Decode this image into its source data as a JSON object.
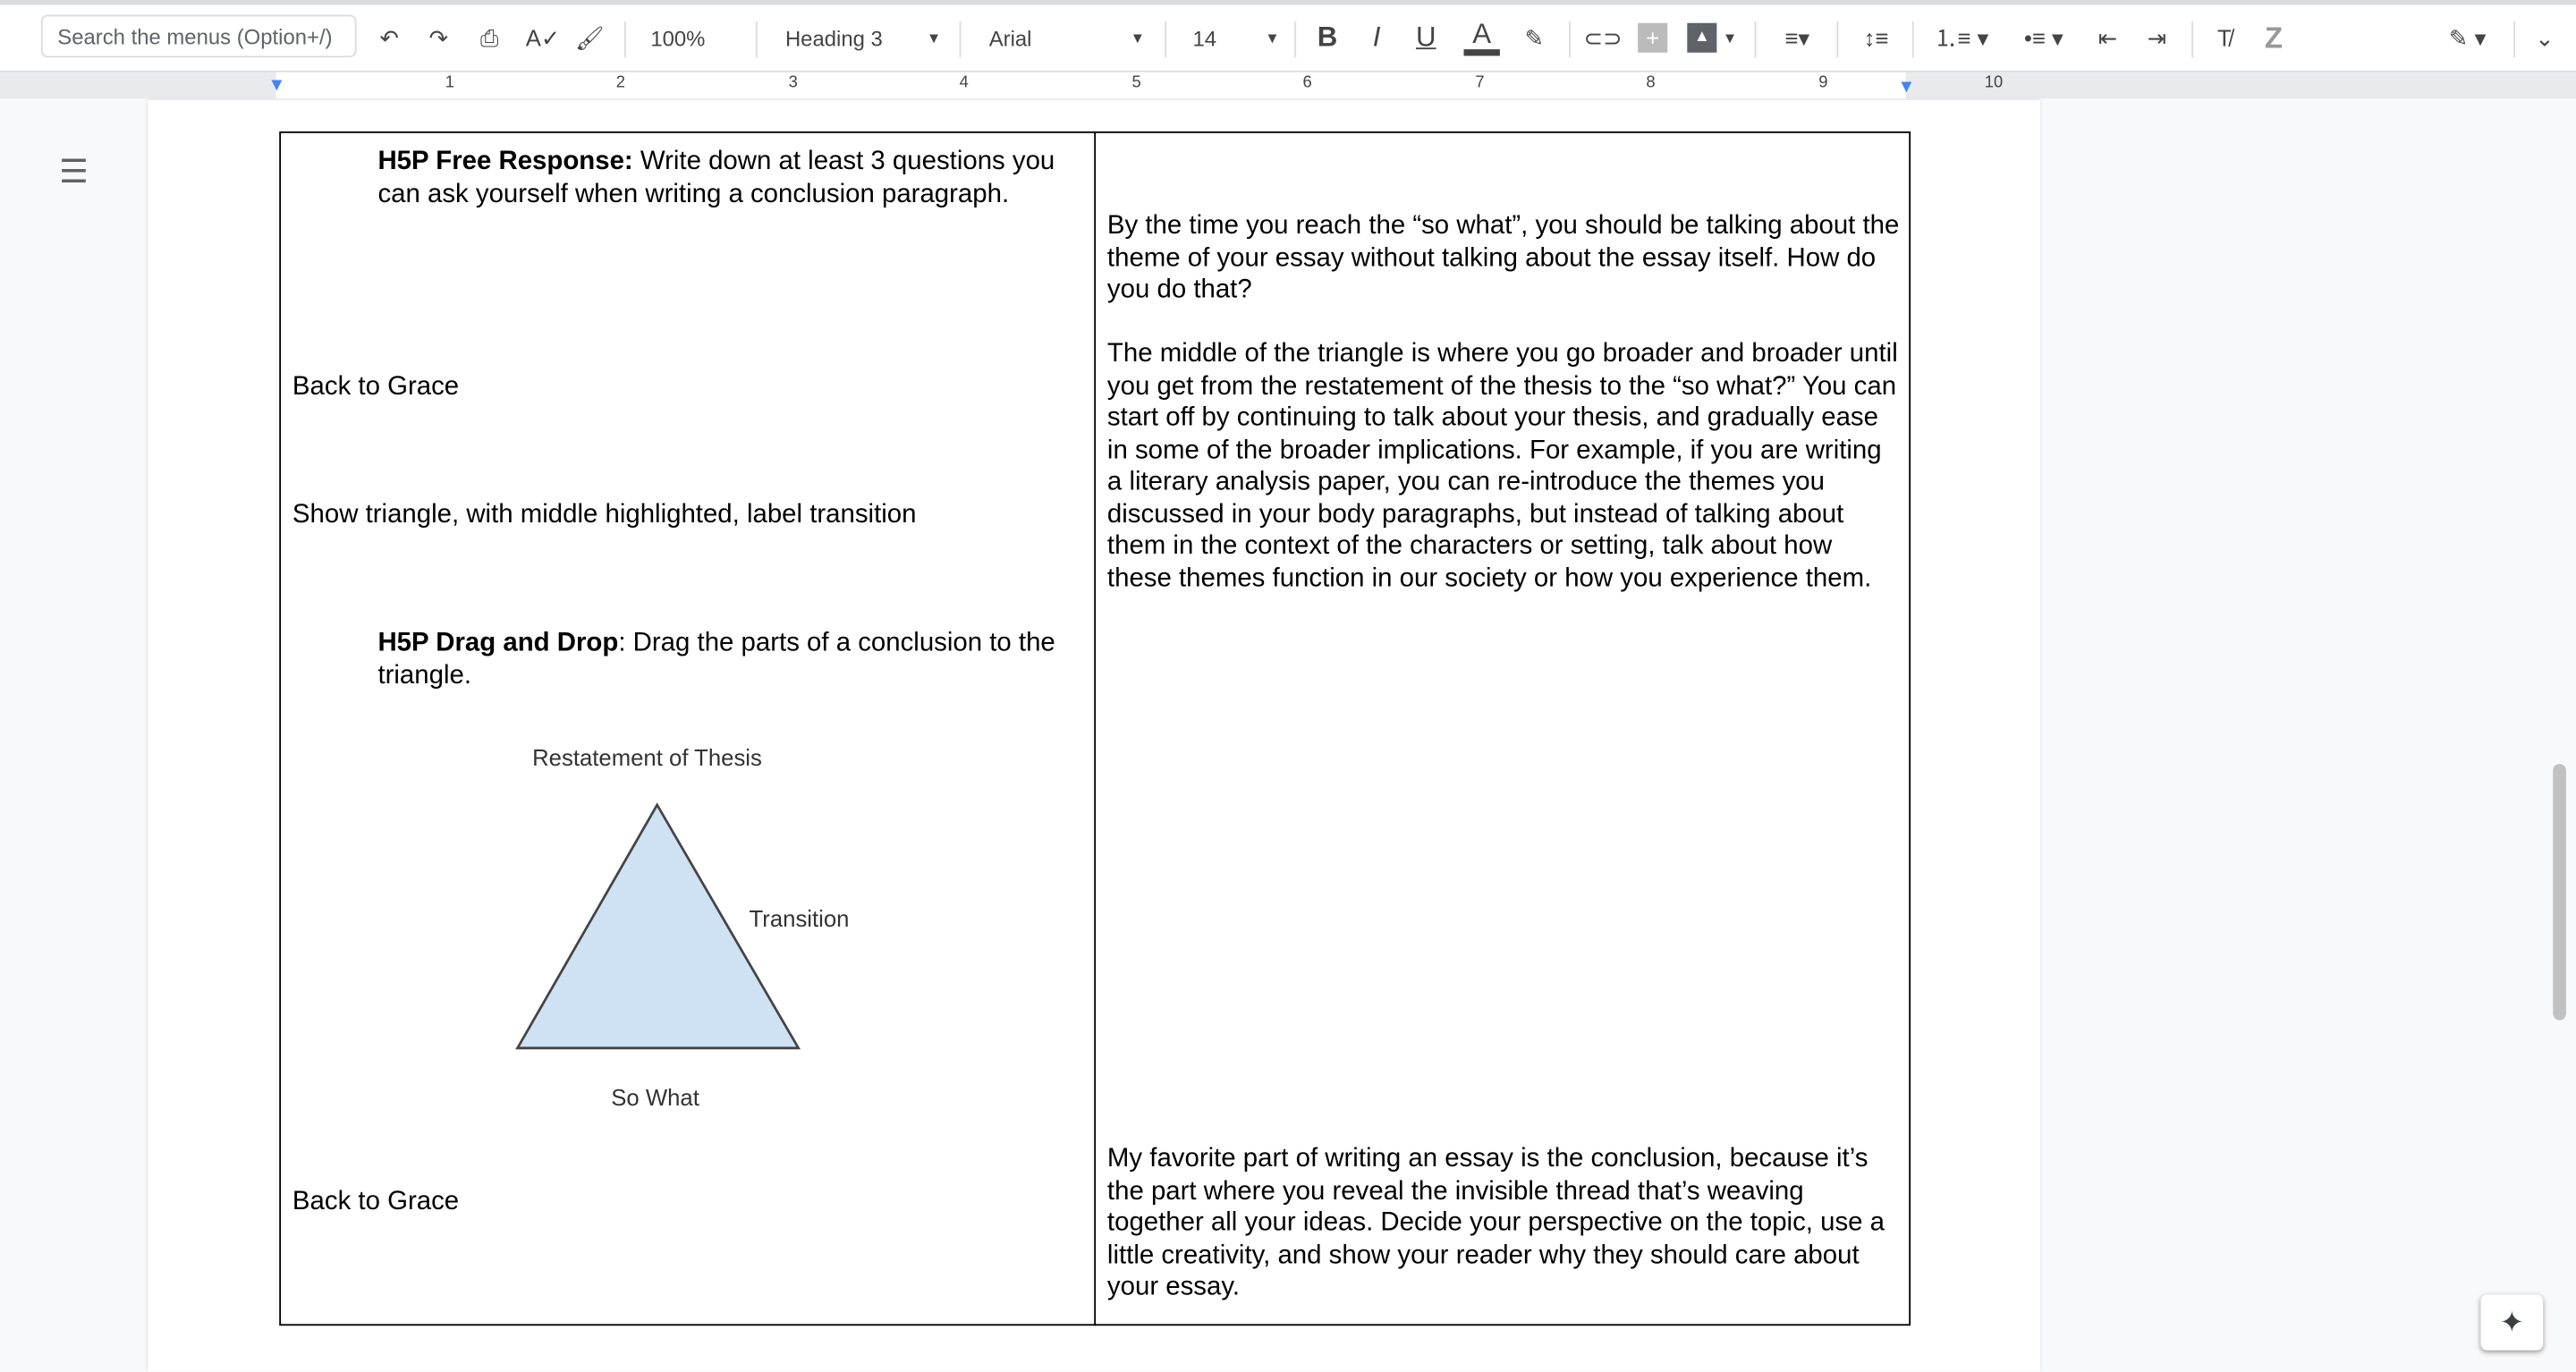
{
  "toolbar": {
    "search_placeholder": "Search the menus (Option+/)",
    "zoom": "100%",
    "style": "Heading 3",
    "font": "Arial",
    "size": "14"
  },
  "ruler": {
    "numbers": [
      "1",
      "2",
      "3",
      "4",
      "5",
      "6",
      "7",
      "8",
      "9",
      "10"
    ]
  },
  "left": {
    "p1_bold": "H5P Free Response:",
    "p1_rest": " Write down at least 3 questions you can ask yourself when writing a conclusion paragraph.",
    "back1": "Back to Grace",
    "show": "Show triangle, with middle highlighted, label transition",
    "p2_bold": "H5P Drag and Drop",
    "p2_rest": ": Drag the parts of a conclusion to the triangle.",
    "diagram": {
      "top": "Restatement of Thesis",
      "side": "Transition",
      "bottom": "So What",
      "fill": "#cfe2f3"
    },
    "back2": "Back to Grace"
  },
  "right": {
    "p1": "By the time you reach the “so what”, you should be talking about the theme of your essay without talking about the essay itself. How do you do that?",
    "p2": "The middle of the triangle is where you go broader and broader until you get from the restatement of the thesis to the “so what?” You can start off by continuing to talk about your thesis, and gradually ease in some of the broader implications. For example, if you are writing a literary analysis paper, you can re-introduce the themes you discussed in your body paragraphs, but instead of talking about them in the context of the characters or setting, talk about how these themes function in our society or how you experience them.",
    "p3": "My favorite part of writing an essay is the conclusion, because it’s the part where you reveal the invisible thread that’s weaving together all your ideas. Decide your perspective on the topic, use a little creativity, and show your reader why they should care about your essay."
  }
}
